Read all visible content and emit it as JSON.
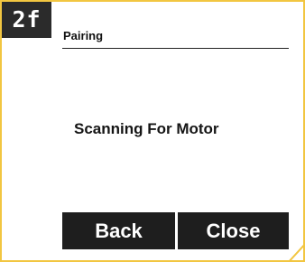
{
  "step": {
    "badge": "2f"
  },
  "screen": {
    "title": "Pairing",
    "status": "Scanning For Motor"
  },
  "buttons": {
    "back_label": "Back",
    "close_label": "Close"
  },
  "colors": {
    "border_accent": "#f2c641",
    "badge_bg": "#2b2b2b",
    "button_bg": "#1e1e1e",
    "button_text": "#ffffff",
    "text": "#151515"
  }
}
